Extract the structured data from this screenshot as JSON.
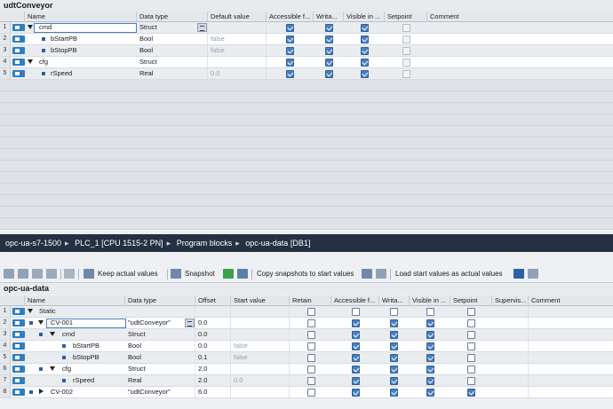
{
  "udt": {
    "title": "udtConveyor",
    "columns": [
      "Name",
      "Data type",
      "Default value",
      "Accessible f...",
      "Writa...",
      "Visible in ...",
      "Setpoint",
      "Comment"
    ],
    "rows": [
      {
        "n": "1",
        "name": "cmd",
        "type": "Struct",
        "def": "",
        "acc": true,
        "wri": true,
        "vis": true,
        "set": false
      },
      {
        "n": "2",
        "name": "bStartPB",
        "type": "Bool",
        "def": "false",
        "acc": true,
        "wri": true,
        "vis": true,
        "set": false
      },
      {
        "n": "3",
        "name": "bStopPB",
        "type": "Bool",
        "def": "false",
        "acc": true,
        "wri": true,
        "vis": true,
        "set": false
      },
      {
        "n": "4",
        "name": "cfg",
        "type": "Struct",
        "def": "",
        "acc": true,
        "wri": true,
        "vis": true,
        "set": false
      },
      {
        "n": "5",
        "name": "rSpeed",
        "type": "Real",
        "def": "0.0",
        "acc": true,
        "wri": true,
        "vis": true,
        "set": false
      }
    ]
  },
  "breadcrumb": [
    "opc-ua-s7-1500",
    "PLC_1 [CPU 1515-2 PN]",
    "Program blocks",
    "opc-ua-data [DB1]"
  ],
  "toolbar": {
    "keep_actual": "Keep actual values",
    "snapshot": "Snapshot",
    "copy_snapshots": "Copy snapshots to start values",
    "load_start": "Load start values as actual values"
  },
  "db": {
    "title": "opc-ua-data",
    "columns": [
      "Name",
      "Data type",
      "Offset",
      "Start value",
      "Retain",
      "Accessible f...",
      "Writa...",
      "Visible in ...",
      "Setpoint",
      "Supervis...",
      "Comment"
    ],
    "rows": [
      {
        "n": "1",
        "name": "Static",
        "type": "",
        "off": "",
        "start": "",
        "ret": false,
        "acc": false,
        "wri": false,
        "vis": false,
        "set": false
      },
      {
        "n": "2",
        "name": "CV-001",
        "type": "\"udtConveyor\"",
        "off": "0.0",
        "start": "",
        "ret": false,
        "acc": true,
        "wri": true,
        "vis": true,
        "set": false
      },
      {
        "n": "3",
        "name": "cmd",
        "type": "Struct",
        "off": "0.0",
        "start": "",
        "ret": false,
        "acc": true,
        "wri": true,
        "vis": true,
        "set": false
      },
      {
        "n": "4",
        "name": "bStartPB",
        "type": "Bool",
        "off": "0.0",
        "start": "false",
        "ret": false,
        "acc": true,
        "wri": true,
        "vis": true,
        "set": false
      },
      {
        "n": "5",
        "name": "bStopPB",
        "type": "Bool",
        "off": "0.1",
        "start": "false",
        "ret": false,
        "acc": true,
        "wri": true,
        "vis": true,
        "set": false
      },
      {
        "n": "6",
        "name": "cfg",
        "type": "Struct",
        "off": "2.0",
        "start": "",
        "ret": false,
        "acc": true,
        "wri": true,
        "vis": true,
        "set": false
      },
      {
        "n": "7",
        "name": "rSpeed",
        "type": "Real",
        "off": "2.0",
        "start": "0.0",
        "ret": false,
        "acc": true,
        "wri": true,
        "vis": true,
        "set": false
      },
      {
        "n": "8",
        "name": "CV-002",
        "type": "\"udtConveyor\"",
        "off": "6.0",
        "start": "",
        "ret": false,
        "acc": true,
        "wri": true,
        "vis": true,
        "set": true
      }
    ]
  }
}
